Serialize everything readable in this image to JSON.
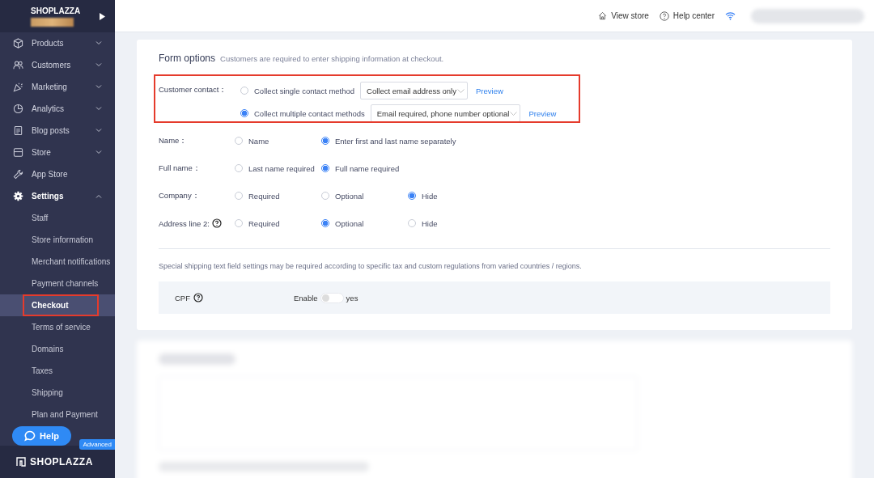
{
  "sidebar": {
    "brand": "SHOPLAZZA",
    "items": [
      {
        "label": "Products",
        "kind": "group",
        "expanded": false
      },
      {
        "label": "Customers",
        "kind": "group",
        "expanded": false
      },
      {
        "label": "Marketing",
        "kind": "group",
        "expanded": false
      },
      {
        "label": "Analytics",
        "kind": "group",
        "expanded": false
      },
      {
        "label": "Blog posts",
        "kind": "group",
        "expanded": false
      },
      {
        "label": "Store",
        "kind": "group",
        "expanded": false
      },
      {
        "label": "App Store",
        "kind": "link"
      },
      {
        "label": "Settings",
        "kind": "group",
        "expanded": true,
        "children": [
          {
            "label": "Staff",
            "selected": false
          },
          {
            "label": "Store information",
            "selected": false
          },
          {
            "label": "Merchant notifications",
            "selected": false
          },
          {
            "label": "Payment channels",
            "selected": false
          },
          {
            "label": "Checkout",
            "selected": true
          },
          {
            "label": "Terms of service",
            "selected": false
          },
          {
            "label": "Domains",
            "selected": false
          },
          {
            "label": "Taxes",
            "selected": false
          },
          {
            "label": "Shipping",
            "selected": false
          },
          {
            "label": "Plan and Payment",
            "selected": false
          }
        ]
      }
    ],
    "help_button": "Help",
    "plan_badge": "Advanced",
    "footer_logo": "SHOPLAZZA"
  },
  "header": {
    "links": [
      "View store",
      "Help center"
    ]
  },
  "form": {
    "title": "Form options",
    "subtitle": "Customers are required to enter shipping information at checkout.",
    "contact": {
      "label": "Customer contact：",
      "options": [
        {
          "label": "Collect single contact method",
          "selected": false,
          "dropdown": "Collect email address only",
          "link": "Preview"
        },
        {
          "label": "Collect multiple contact methods",
          "selected": true,
          "dropdown": "Email required, phone number optional",
          "link": "Preview"
        }
      ]
    },
    "rows": [
      {
        "label": "Name：",
        "help": false,
        "options": [
          {
            "label": "Name",
            "selected": false
          },
          {
            "label": "Enter first and last name separately",
            "selected": true
          }
        ]
      },
      {
        "label": "Full name：",
        "help": false,
        "options": [
          {
            "label": "Last name required",
            "selected": false
          },
          {
            "label": "Full name required",
            "selected": true
          }
        ]
      },
      {
        "label": "Company：",
        "help": false,
        "options": [
          {
            "label": "Required",
            "selected": false
          },
          {
            "label": "Optional",
            "selected": false
          },
          {
            "label": "Hide",
            "selected": true
          }
        ]
      },
      {
        "label": "Address line 2:",
        "help": true,
        "options": [
          {
            "label": "Required",
            "selected": false
          },
          {
            "label": "Optional",
            "selected": true
          },
          {
            "label": "Hide",
            "selected": false
          }
        ]
      }
    ],
    "note": "Special shipping text field settings may be required according to specific tax and custom regulations from varied countries / regions.",
    "cpf": {
      "label": "CPF",
      "toggle_label": "Enable",
      "on": false,
      "value_label": "yes"
    }
  }
}
